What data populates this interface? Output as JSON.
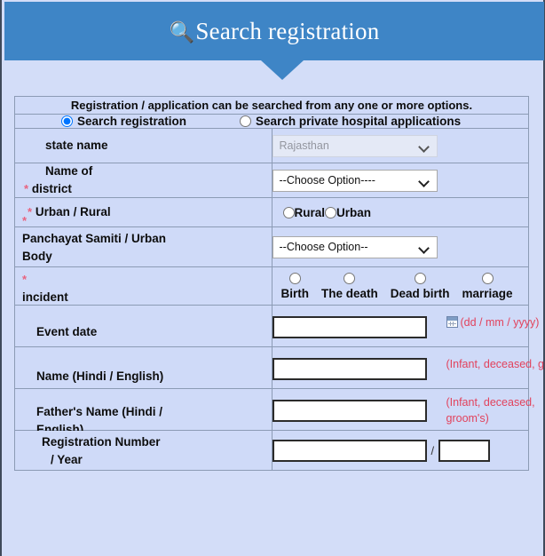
{
  "header": {
    "title": "Search registration",
    "icon": "search-icon",
    "bg_color": "#3e85c6"
  },
  "notice": {
    "text": "Registration / application can be searched from any one or more options.",
    "color": "#fb0606"
  },
  "mode": {
    "options": [
      {
        "label": "Search registration",
        "selected": true
      },
      {
        "label": "Search private hospital applications",
        "selected": false
      }
    ]
  },
  "form": {
    "state": {
      "label": "state name",
      "value": "Rajasthan",
      "disabled": true
    },
    "district": {
      "label_line1": "Name of",
      "label_line2": "district",
      "required": "*",
      "value": "--Choose Option----"
    },
    "urban_rural": {
      "label": "Urban / Rural",
      "required": "*",
      "options": [
        "Rural",
        "Urban"
      ]
    },
    "panchayat": {
      "required": "*",
      "label": "Panchayat Samiti / Urban Body",
      "value": "--Choose Option--"
    },
    "incident": {
      "required": "*",
      "label": "incident",
      "options": [
        "Birth",
        "The death",
        "Dead birth",
        "marriage"
      ]
    },
    "event_date": {
      "label": "Event date",
      "value": "",
      "hint": "(dd / mm / yyyy)",
      "icon": "calendar-icon"
    },
    "name": {
      "label": "Name (Hindi / English)",
      "value": "",
      "hint": "(Infant, deceased, groom)"
    },
    "father_name": {
      "label": "Father's Name (Hindi / English)",
      "value": "",
      "hint": "(Infant, deceased, groom's)"
    },
    "registration": {
      "label_line1": "Registration Number",
      "label_line2": "/ Year",
      "number_value": "",
      "separator": "/",
      "year_value": ""
    }
  }
}
